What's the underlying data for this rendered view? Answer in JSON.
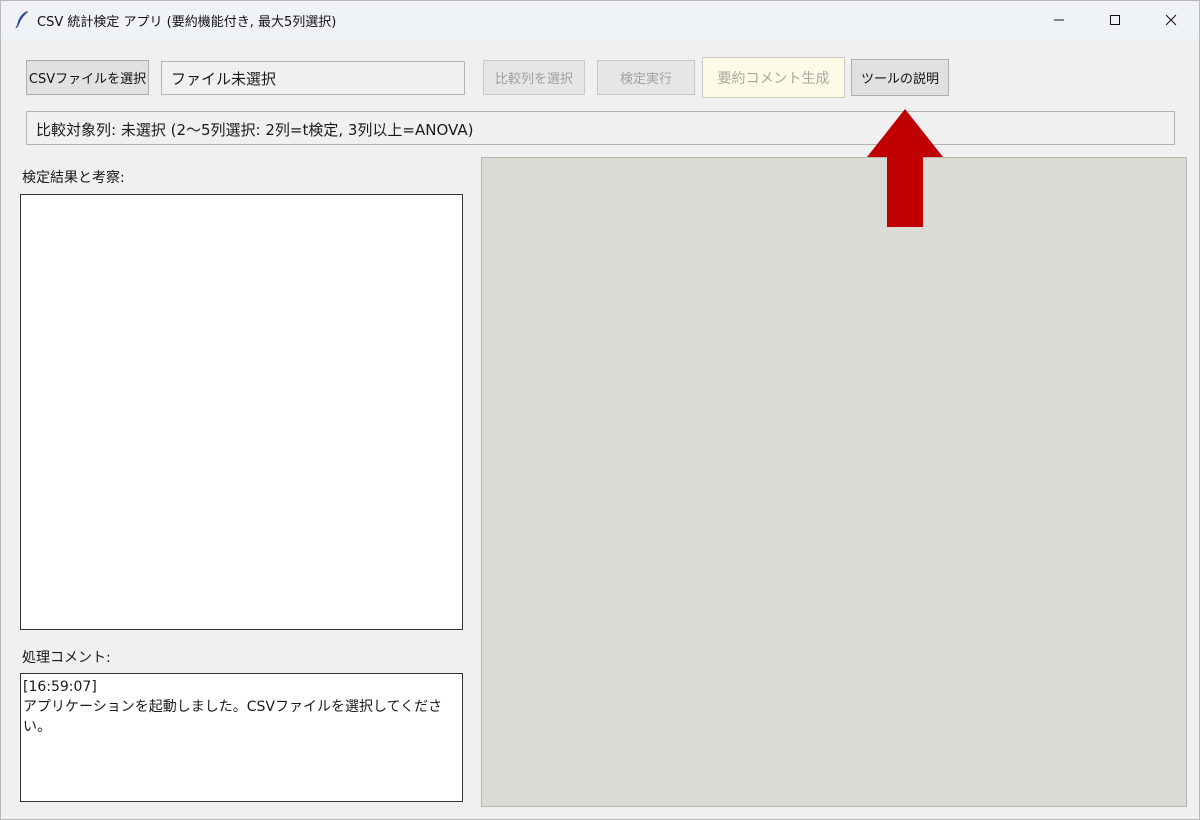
{
  "window": {
    "title": "CSV 統計検定 アプリ (要約機能付き, 最大5列選択)",
    "icon": "feather-icon"
  },
  "toolbar": {
    "select_csv_label": "CSVファイルを選択",
    "file_field_value": "ファイル未選択",
    "select_columns_label": "比較列を選択",
    "run_test_label": "検定実行",
    "summary_label": "要約コメント生成",
    "help_label": "ツールの説明"
  },
  "status": {
    "text": "比較対象列: 未選択 (2～5列選択: 2列=t検定, 3列以上=ANOVA)"
  },
  "results": {
    "label": "検定結果と考察:",
    "content": ""
  },
  "log": {
    "label": "処理コメント:",
    "content": "[16:59:07]\nアプリケーションを起動しました。CSVファイルを選択してください。"
  },
  "colors": {
    "arrow": "#c00000",
    "plot_background": "#dcdad5",
    "window_background": "#f0f0f0"
  }
}
